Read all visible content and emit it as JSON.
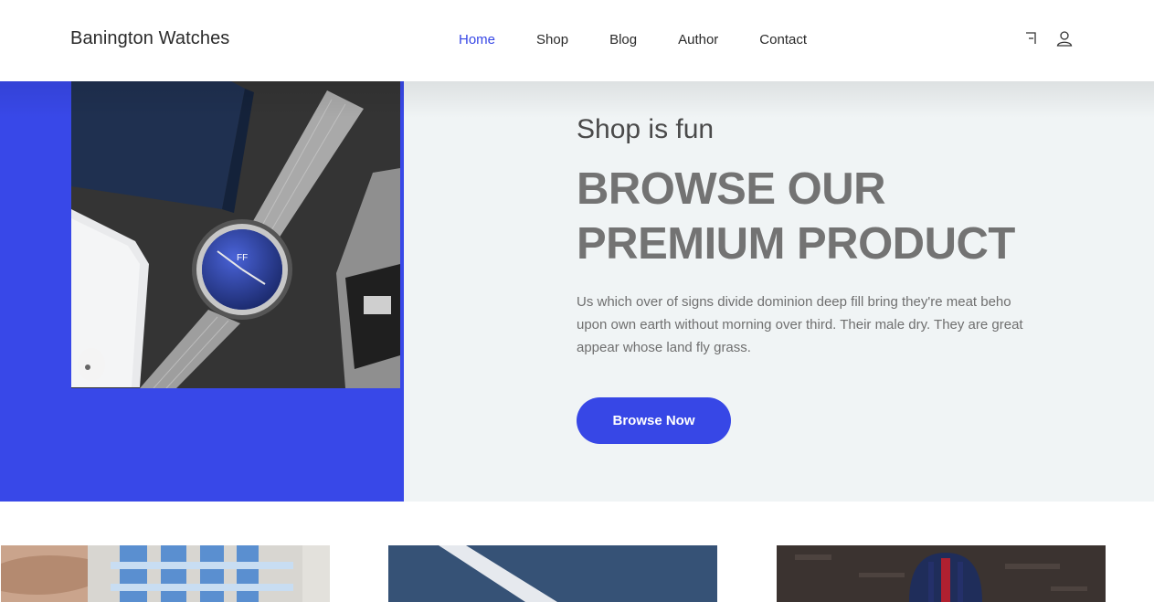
{
  "header": {
    "brand": "Banington Watches",
    "nav": [
      {
        "label": "Home",
        "active": true
      },
      {
        "label": "Shop",
        "active": false
      },
      {
        "label": "Blog",
        "active": false
      },
      {
        "label": "Author",
        "active": false
      },
      {
        "label": "Contact",
        "active": false
      }
    ],
    "icons": [
      "cart-icon",
      "user-icon"
    ]
  },
  "hero": {
    "kicker": "Shop is fun",
    "headline_line1": "BROWSE OUR",
    "headline_line2": "PREMIUM PRODUCT",
    "description": "Us which over of signs divide dominion deep fill bring they're meat beho upon own earth without morning over third. Their male dry. They are great appear whose land fly grass.",
    "cta_label": "Browse Now",
    "image": "wristwatch-product-photo"
  },
  "cards": [
    {
      "image": "person-striped-shirt-photo"
    },
    {
      "image": "blue-watch-strap-photo"
    },
    {
      "image": "watch-nato-strap-photo"
    }
  ],
  "colors": {
    "accent": "#3747e6",
    "hero_bg": "#f0f4f5",
    "headline": "#737373"
  }
}
